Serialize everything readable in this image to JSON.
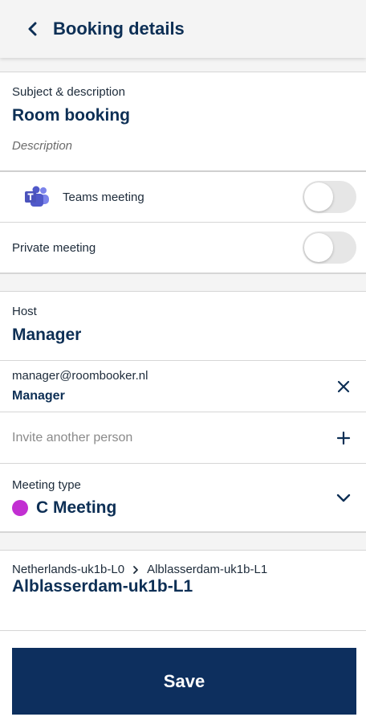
{
  "header": {
    "title": "Booking details",
    "back_icon": "chevron-left-icon"
  },
  "subject": {
    "label": "Subject & description",
    "title": "Room booking",
    "description_placeholder": "Description"
  },
  "teams": {
    "label": "Teams meeting",
    "icon": "microsoft-teams-icon",
    "enabled": false
  },
  "private": {
    "label": "Private meeting",
    "enabled": false
  },
  "host": {
    "label": "Host",
    "name": "Manager"
  },
  "attendee": {
    "email": "manager@roombooker.nl",
    "name": "Manager",
    "remove_icon": "close-icon"
  },
  "invite": {
    "placeholder": "Invite another person",
    "add_icon": "plus-icon"
  },
  "meeting_type": {
    "label": "Meeting type",
    "value": "C Meeting",
    "color": "#c22fd2",
    "expand_icon": "chevron-down-icon"
  },
  "location": {
    "breadcrumb": [
      "Netherlands-uk1b-L0",
      "Alblasserdam-uk1b-L1"
    ],
    "name": "Alblasserdam-uk1b-L1"
  },
  "save": {
    "label": "Save"
  },
  "colors": {
    "primary": "#0d2f5e",
    "text": "#0d2f55",
    "background": "#f4f4f4",
    "accent_dot": "#c22fd2"
  }
}
